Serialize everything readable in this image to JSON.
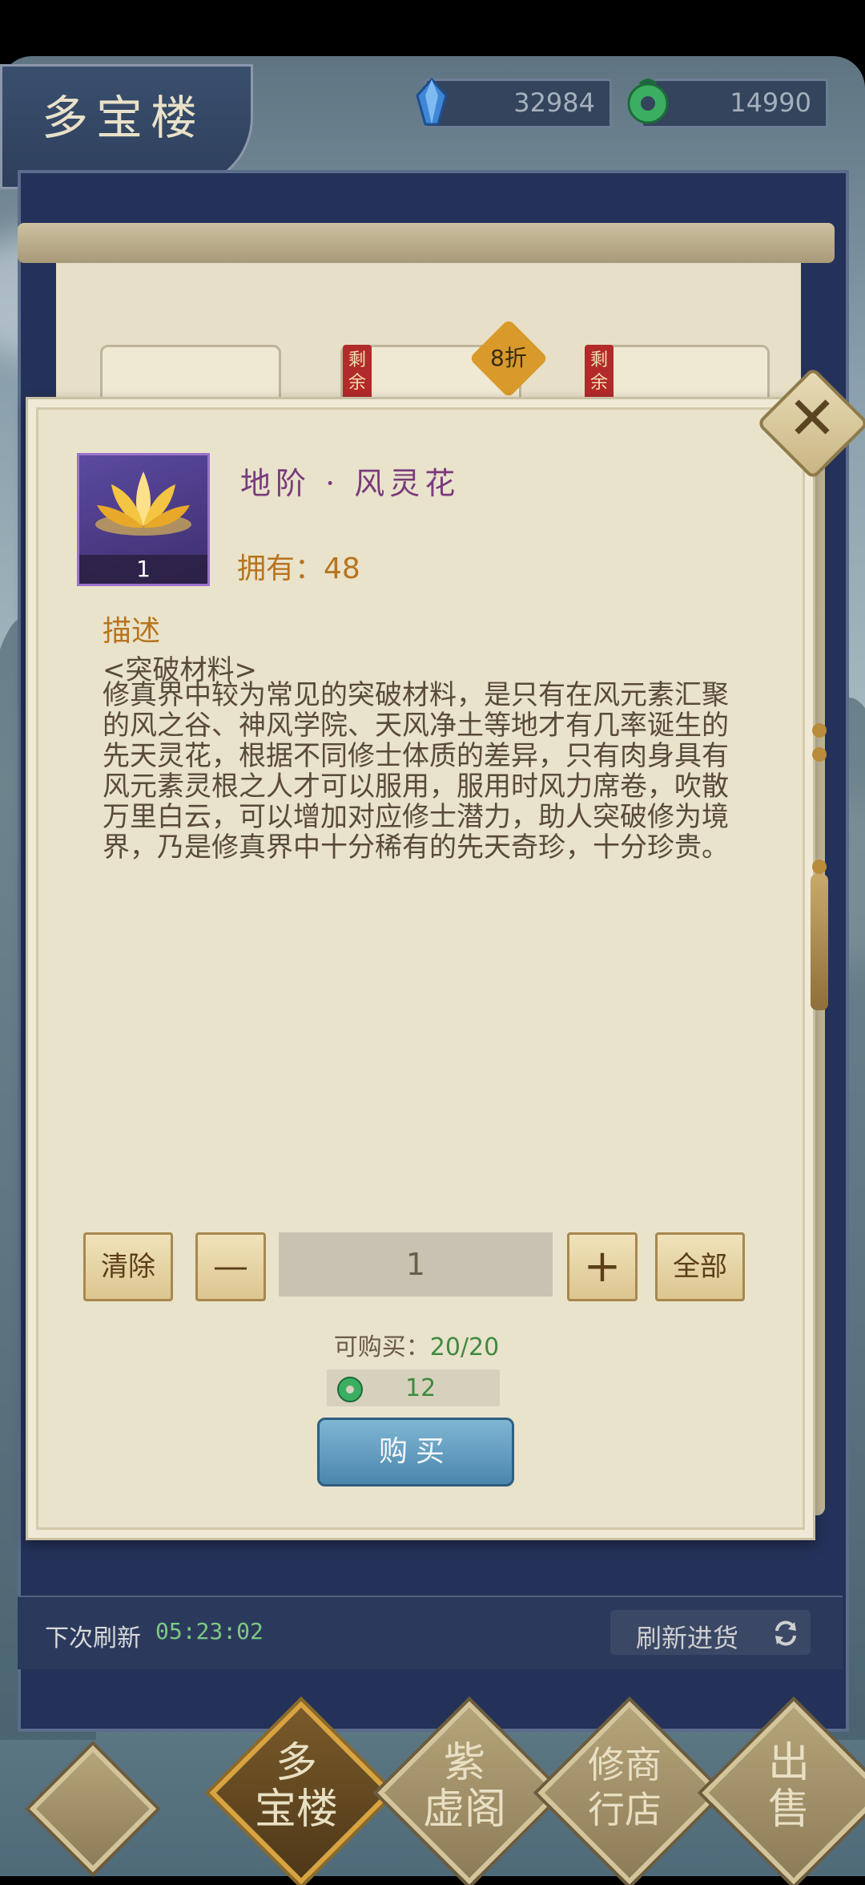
{
  "header": {
    "title": "多宝楼",
    "currency_crystal": "32984",
    "currency_jade": "14990"
  },
  "shop": {
    "remain_label": "剩余",
    "discount": "8折"
  },
  "modal": {
    "item_name": "地阶 · 风灵花",
    "item_count": "1",
    "owned_label": "拥有：",
    "owned_value": "48",
    "desc_title": "描述",
    "desc_category": "<突破材料>",
    "desc_body": "修真界中较为常见的突破材料，是只有在风元素汇聚的风之谷、神风学院、天风净土等地才有几率诞生的先天灵花，根据不同修士体质的差异，只有肉身具有风元素灵根之人才可以服用，服用时风力席卷，吹散万里白云，可以增加对应修士潜力，助人突破修为境界，乃是修真界中十分稀有的先天奇珍，十分珍贵。",
    "clear_label": "清除",
    "minus_label": "—",
    "quantity": "1",
    "plus_label": "+",
    "all_label": "全部",
    "limit_label": "可购买：",
    "limit_value": "20/20",
    "price": "12",
    "buy_label": "购买"
  },
  "refresh": {
    "label": "下次刷新",
    "time": "05:23:02",
    "button_label": "刷新进货"
  },
  "nav": {
    "items": [
      {
        "label": "多宝楼",
        "l1": "多",
        "l2": "宝楼"
      },
      {
        "label": "紫虚阁",
        "l1": "紫",
        "l2": "虚阁"
      },
      {
        "label": "修商行店",
        "l1": "修商",
        "l2": "行店"
      },
      {
        "label": "出售",
        "l1": "出",
        "l2": "售"
      }
    ]
  },
  "colors": {
    "accent_orange": "#b7741e",
    "item_purple": "#7a3b7c",
    "price_green": "#3f8a3e",
    "board_navy": "#24325a"
  },
  "icons": {
    "crystal": "blue-crystal-icon",
    "jade": "jade-coin-icon",
    "item": "golden-lotus-icon",
    "refresh": "refresh-arrows-icon",
    "close": "close-icon"
  }
}
